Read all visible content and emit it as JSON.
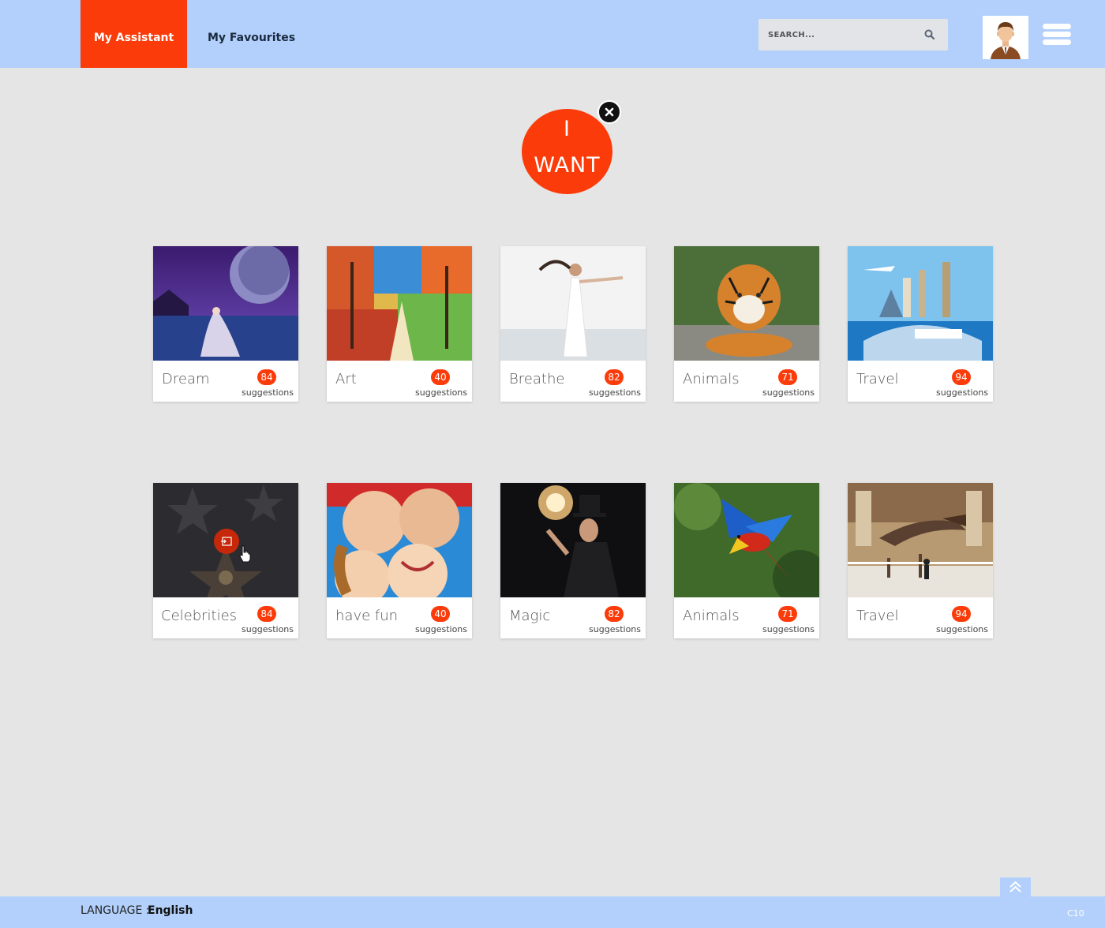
{
  "header": {
    "tabs": [
      {
        "label": "My Assistant",
        "active": true
      },
      {
        "label": "My Favourites",
        "active": false
      }
    ],
    "search": {
      "placeholder": "SEARCH..."
    }
  },
  "hero": {
    "line1": "I",
    "line2": "WANT"
  },
  "cards": [
    {
      "label": "Dream",
      "count": "84",
      "suffix": "suggestions"
    },
    {
      "label": "Art",
      "count": "40",
      "suffix": "suggestions"
    },
    {
      "label": "Breathe",
      "count": "82",
      "suffix": "suggestions"
    },
    {
      "label": "Animals",
      "count": "71",
      "suffix": "suggestions"
    },
    {
      "label": "Travel",
      "count": "94",
      "suffix": "suggestions"
    },
    {
      "label": "Celebrities",
      "count": "84",
      "suffix": "suggestions"
    },
    {
      "label": "have fun",
      "count": "40",
      "suffix": "suggestions"
    },
    {
      "label": "Magic",
      "count": "82",
      "suffix": "suggestions"
    },
    {
      "label": "Animals",
      "count": "71",
      "suffix": "suggestions"
    },
    {
      "label": "Travel",
      "count": "94",
      "suffix": "suggestions"
    }
  ],
  "footer": {
    "language_label": "LANGUAGE :",
    "language_value": "English",
    "code": "C10"
  },
  "colors": {
    "accent": "#fb3c0a",
    "bar": "#b2d0fb",
    "background": "#e5e5e5"
  }
}
